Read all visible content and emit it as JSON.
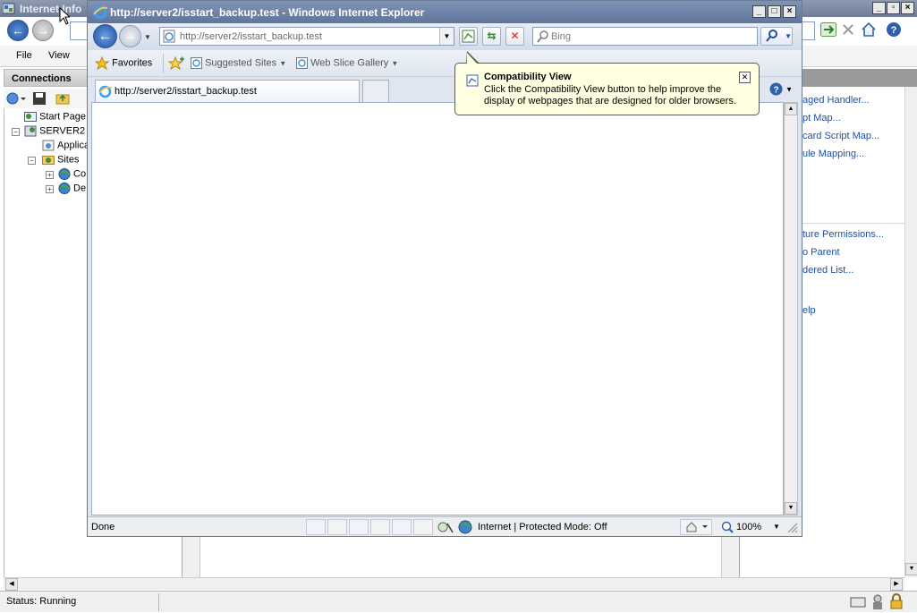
{
  "iis": {
    "title": "Internet Info",
    "menu": [
      "File",
      "View"
    ],
    "connections_label": "Connections",
    "tree": {
      "start_page": "Start Page",
      "server": "SERVER2 (",
      "app_pools": "Applica",
      "sites": "Sites",
      "site1": "Co",
      "site2": "De"
    },
    "actions": {
      "add_managed_handler": "aged Handler...",
      "add_script_map": "pt Map...",
      "add_wildcard_script_map": "card Script Map...",
      "add_module_mapping": "ule Mapping...",
      "edit_feature_permissions": "ture Permissions...",
      "revert_to_parent": "o Parent",
      "view_ordered_list": "dered List...",
      "help": "elp"
    },
    "status": "Status: Running"
  },
  "ie": {
    "title": "http://server2/isstart_backup.test - Windows Internet Explorer",
    "address": "http://server2/isstart_backup.test",
    "search_placeholder": "Bing",
    "favorites_label": "Favorites",
    "suggested_sites_label": "Suggested Sites",
    "web_slice_label": "Web Slice Gallery",
    "tab_label": "http://server2/isstart_backup.test",
    "status_done": "Done",
    "zone": "Internet | Protected Mode: Off",
    "zoom": "100%"
  },
  "tooltip": {
    "title": "Compatibility View",
    "body": "Click the Compatibility View button to help improve the display of webpages that are designed for older browsers."
  },
  "colors": {
    "ie_title_bg": "#6b80a6",
    "tooltip_bg": "#ffffe1",
    "action_link": "#1d4fa8"
  }
}
